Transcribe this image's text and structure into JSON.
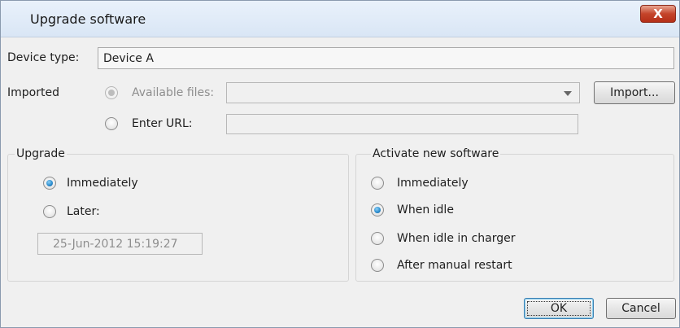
{
  "window": {
    "title": "Upgrade software",
    "close_label": "X"
  },
  "device": {
    "label": "Device type:",
    "value": "Device A"
  },
  "imported": {
    "label": "Imported",
    "available_label": "Available files:",
    "available_value": "",
    "import_button": "Import...",
    "url_label": "Enter URL:",
    "url_value": ""
  },
  "upgrade": {
    "legend": "Upgrade",
    "options": [
      "Immediately",
      "Later:"
    ],
    "selected": "Immediately",
    "later_datetime": "25-Jun-2012 15:19:27"
  },
  "activate": {
    "legend": "Activate new software",
    "options": [
      "Immediately",
      "When idle",
      "When idle in charger",
      "After manual restart"
    ],
    "selected": "When idle"
  },
  "buttons": {
    "ok": "OK",
    "cancel": "Cancel"
  },
  "colors": {
    "radio_selected": "#2d8fd0",
    "close_button": "#c4442a"
  }
}
